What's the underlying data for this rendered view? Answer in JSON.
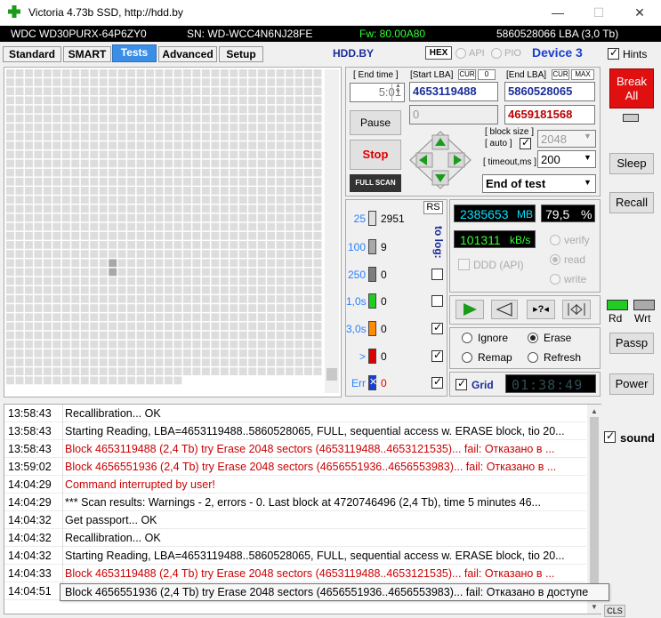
{
  "window": {
    "title": "Victoria 4.73b SSD, http://hdd.by",
    "minimize": "—",
    "maximize": "☐",
    "close": "✕",
    "icon_color": "#1a9c1a"
  },
  "drive": {
    "model": "WDC WD30PURX-64P6ZY0",
    "serial": "SN: WD-WCC4N6NJ28FE",
    "firmware": "Fw: 80.00A80",
    "capacity": "5860528066 LBA (3,0 Tb)",
    "firmware_color": "#33ff33"
  },
  "tabs": [
    "Standard",
    "SMART",
    "Tests",
    "Advanced",
    "Setup"
  ],
  "active_tab": "Tests",
  "header": {
    "brand": "HDD.BY",
    "hex": "HEX",
    "api": "API",
    "pio": "PIO",
    "device": "Device 3",
    "hints": "Hints"
  },
  "controls": {
    "end_time_label": "[ End time ]",
    "end_time_value": "5:01",
    "start_lba_label": "[Start LBA]",
    "start_cur": "CUR",
    "start_zero": "0",
    "start_lba_value": "4653119488",
    "start_lba_secondary": "0",
    "end_lba_label": "[End LBA]",
    "end_cur": "CUR",
    "end_max": "MAX",
    "end_lba_value": "5860528065",
    "end_lba_secondary": "4659181568",
    "pause": "Pause",
    "stop": "Stop",
    "full_scan": "FULL SCAN",
    "block_size_label": "[ block size ]",
    "auto_label": "[ auto ]",
    "block_size_value": "2048",
    "timeout_label": "[ timeout,ms ]",
    "timeout_value": "200",
    "end_action": "End of test",
    "rs": "RS",
    "to_log": "to log:"
  },
  "legend": [
    {
      "label": "25",
      "count": "2951",
      "color": "#e0e0e0",
      "label_color": "#2a7fff"
    },
    {
      "label": "100",
      "count": "9",
      "color": "#a8a8a8",
      "label_color": "#2a7fff"
    },
    {
      "label": "250",
      "count": "0",
      "color": "#7e7e7e",
      "label_color": "#2a7fff"
    },
    {
      "label": "1,0s",
      "count": "0",
      "color": "#22cc22",
      "label_color": "#2a7fff"
    },
    {
      "label": "3,0s",
      "count": "0",
      "color": "#ff8c00",
      "label_color": "#2a7fff"
    },
    {
      "label": ">",
      "count": "0",
      "color": "#dd0000",
      "label_color": "#2a7fff"
    },
    {
      "label": "Err",
      "count": "0",
      "color": "#1a3fcc",
      "label_color": "#2a7fff"
    }
  ],
  "stats": {
    "mb_value": "2385653",
    "mb_unit": "MB",
    "percent": "79,5",
    "percent_unit": "%",
    "speed_value": "101311",
    "speed_unit": "kB/s",
    "ddd": "DDD (API)",
    "verify": "verify",
    "read": "read",
    "write": "write",
    "lcd_color": "#00e5ff",
    "speed_color": "#33ff33"
  },
  "modes": {
    "ignore": "Ignore",
    "erase": "Erase",
    "remap": "Remap",
    "refresh": "Refresh",
    "grid": "Grid",
    "timer": "01:38:49"
  },
  "side": {
    "break_all_1": "Break",
    "break_all_2": "All",
    "sleep": "Sleep",
    "recall": "Recall",
    "rd": "Rd",
    "wrt": "Wrt",
    "passp": "Passp",
    "power": "Power",
    "sound": "sound",
    "cls": "CLS"
  },
  "log": [
    {
      "time": "13:58:43",
      "msg": "Recallibration... OK",
      "error": false
    },
    {
      "time": "13:58:43",
      "msg": "Starting Reading, LBA=4653119488..5860528065, FULL, sequential access w. ERASE block, tio 20...",
      "error": false
    },
    {
      "time": "13:58:43",
      "msg": "Block 4653119488 (2,4 Tb) try Erase 2048 sectors (4653119488..4653121535)... fail: Отказано в ...",
      "error": true
    },
    {
      "time": "13:59:02",
      "msg": "Block 4656551936 (2,4 Tb) try Erase 2048 sectors (4656551936..4656553983)... fail: Отказано в ...",
      "error": true
    },
    {
      "time": "14:04:29",
      "msg": "Command interrupted by user!",
      "error": true
    },
    {
      "time": "14:04:29",
      "msg": "*** Scan results: Warnings - 2, errors - 0. Last block at 4720746496 (2,4 Tb), time 5 minutes 46...",
      "error": false
    },
    {
      "time": "14:04:32",
      "msg": "Get passport... OK",
      "error": false
    },
    {
      "time": "14:04:32",
      "msg": "Recallibration... OK",
      "error": false
    },
    {
      "time": "14:04:32",
      "msg": "Starting Reading, LBA=4653119488..5860528065, FULL, sequential access w. ERASE block, tio 20...",
      "error": false
    },
    {
      "time": "14:04:33",
      "msg": "Block 4653119488 (2,4 Tb) try Erase 2048 sectors (4653119488..4653121535)... fail: Отказано в ...",
      "error": true
    },
    {
      "time": "14:04:51",
      "msg": "",
      "error": false
    }
  ],
  "tooltip": "Block 4656551936 (2,4 Tb) try Erase 2048 sectors (4656551936..4656553983)... fail: Отказано в доступе"
}
